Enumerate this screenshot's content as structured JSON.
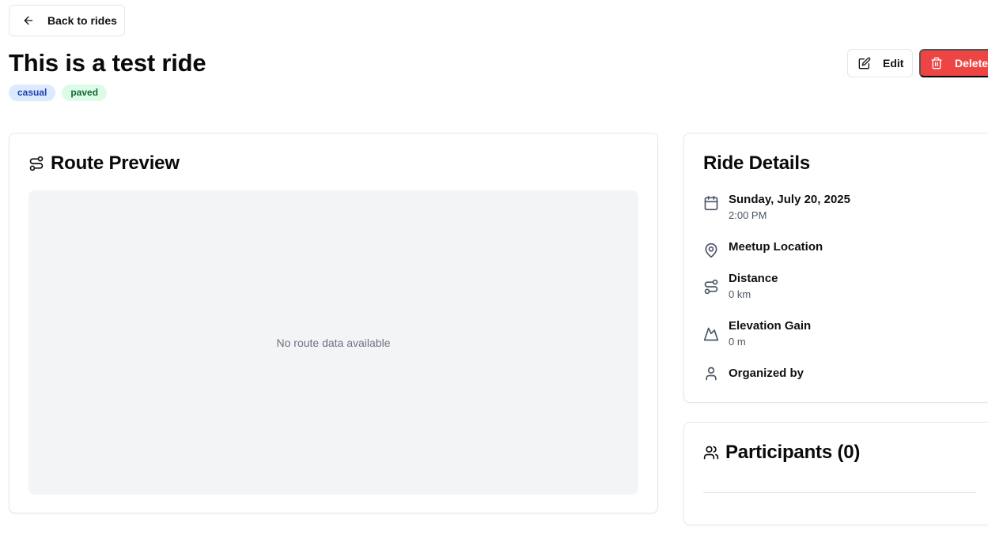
{
  "nav": {
    "back_label": "Back to rides"
  },
  "ride": {
    "title": "This is a test ride",
    "tags": [
      "casual",
      "paved"
    ]
  },
  "actions": {
    "edit_label": "Edit",
    "delete_label": "Delete"
  },
  "route": {
    "title": "Route Preview",
    "empty_text": "No route data available"
  },
  "details": {
    "title": "Ride Details",
    "date": "Sunday, July 20, 2025",
    "time": "2:00 PM",
    "meetup_label": "Meetup Location",
    "distance_label": "Distance",
    "distance_value": "0 km",
    "elevation_label": "Elevation Gain",
    "elevation_value": "0 m",
    "organizer_label": "Organized by"
  },
  "participants": {
    "title": "Participants (0)"
  },
  "colors": {
    "delete": "#ef4444",
    "tag_casual_bg": "#dbeafe",
    "tag_casual_fg": "#1e40af",
    "tag_paved_bg": "#dcfce7",
    "tag_paved_fg": "#166534"
  },
  "icons": {
    "back": "arrow-left-icon",
    "edit": "edit-icon",
    "delete": "trash-icon",
    "route": "route-icon",
    "date": "calendar-icon",
    "meetup": "map-pin-icon",
    "distance": "route-icon",
    "elevation": "mountain-icon",
    "organizer": "user-icon",
    "participants": "users-icon"
  }
}
